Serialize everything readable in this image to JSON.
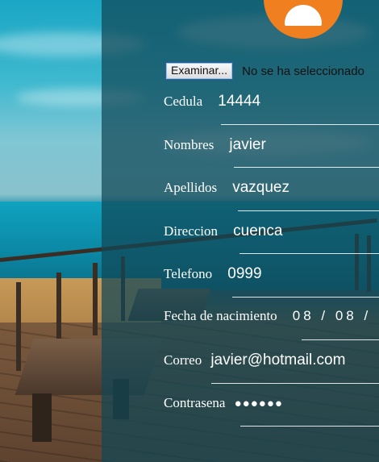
{
  "file_input": {
    "button_label": "Examinar...",
    "status_text": "No se ha seleccionado"
  },
  "fields": [
    {
      "label": "Cedula",
      "value": "14444"
    },
    {
      "label": "Nombres",
      "value": "javier"
    },
    {
      "label": "Apellidos",
      "value": "vazquez"
    },
    {
      "label": "Direccion",
      "value": "cuenca"
    },
    {
      "label": "Telefono",
      "value": "0999"
    },
    {
      "label": "Fecha de nacimiento",
      "value": "08 / 08 /"
    },
    {
      "label": "Correo",
      "value": "javier@hotmail.com"
    },
    {
      "label": "Contrasena",
      "value": "●●●●●●"
    }
  ],
  "colors": {
    "accent": "#f07f20",
    "panel": "#104656"
  },
  "icons": {
    "avatar": "user-avatar-icon"
  }
}
